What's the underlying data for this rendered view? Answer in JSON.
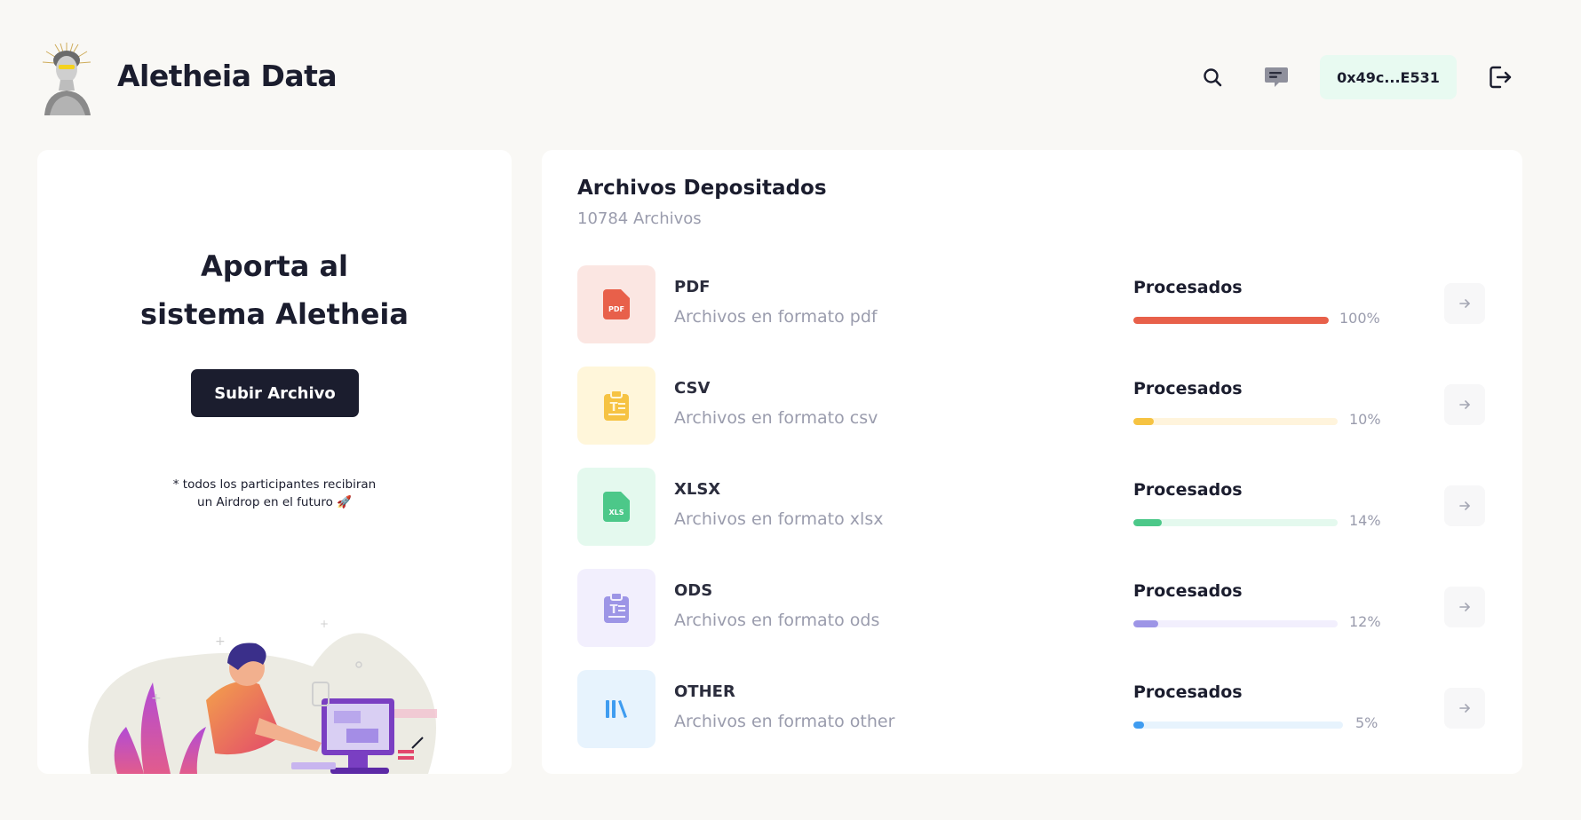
{
  "brand": {
    "name": "Aletheia Data"
  },
  "header": {
    "wallet_address": "0x49c...E531",
    "icons": [
      "search-icon",
      "chat-icon",
      "logout-icon"
    ]
  },
  "contribute": {
    "title_line1": "Aporta al",
    "title_line2": "sistema Aletheia",
    "upload_label": "Subir Archivo",
    "note_line1": "* todos los participantes recibiran",
    "note_line2": "un Airdrop en el futuro 🚀"
  },
  "files": {
    "title": "Archivos Depositados",
    "count_label": "10784 Archivos",
    "rows": [
      {
        "name": "PDF",
        "desc": "Archivos en formato pdf",
        "status": "Procesados",
        "percent": 100,
        "percent_label": "100%",
        "icon": "pdf-file-icon",
        "tile_color": "#fbe6e2",
        "bar_color": "#e8604a",
        "track_color": "#fbe6e2",
        "icon_color": "#e8604a"
      },
      {
        "name": "CSV",
        "desc": "Archivos en formato csv",
        "status": "Procesados",
        "percent": 10,
        "percent_label": "10%",
        "icon": "csv-clipboard-icon",
        "tile_color": "#fff6da",
        "bar_color": "#f6c342",
        "track_color": "#fff4dc",
        "icon_color": "#f6c342"
      },
      {
        "name": "XLSX",
        "desc": "Archivos en formato xlsx",
        "status": "Procesados",
        "percent": 14,
        "percent_label": "14%",
        "icon": "xls-file-icon",
        "tile_color": "#e4f9ee",
        "bar_color": "#4cc889",
        "track_color": "#e4f9ee",
        "icon_color": "#4cc889"
      },
      {
        "name": "ODS",
        "desc": "Archivos en formato ods",
        "status": "Procesados",
        "percent": 12,
        "percent_label": "12%",
        "icon": "ods-clipboard-icon",
        "tile_color": "#f2effd",
        "bar_color": "#9d95e6",
        "track_color": "#f2effd",
        "icon_color": "#9d95e6"
      },
      {
        "name": "OTHER",
        "desc": "Archivos en formato other",
        "status": "Procesados",
        "percent": 5,
        "percent_label": "5%",
        "icon": "library-books-icon",
        "tile_color": "#e7f3fd",
        "bar_color": "#3f9cf0",
        "track_color": "#e7f3fd",
        "icon_color": "#3f9cf0"
      }
    ]
  }
}
